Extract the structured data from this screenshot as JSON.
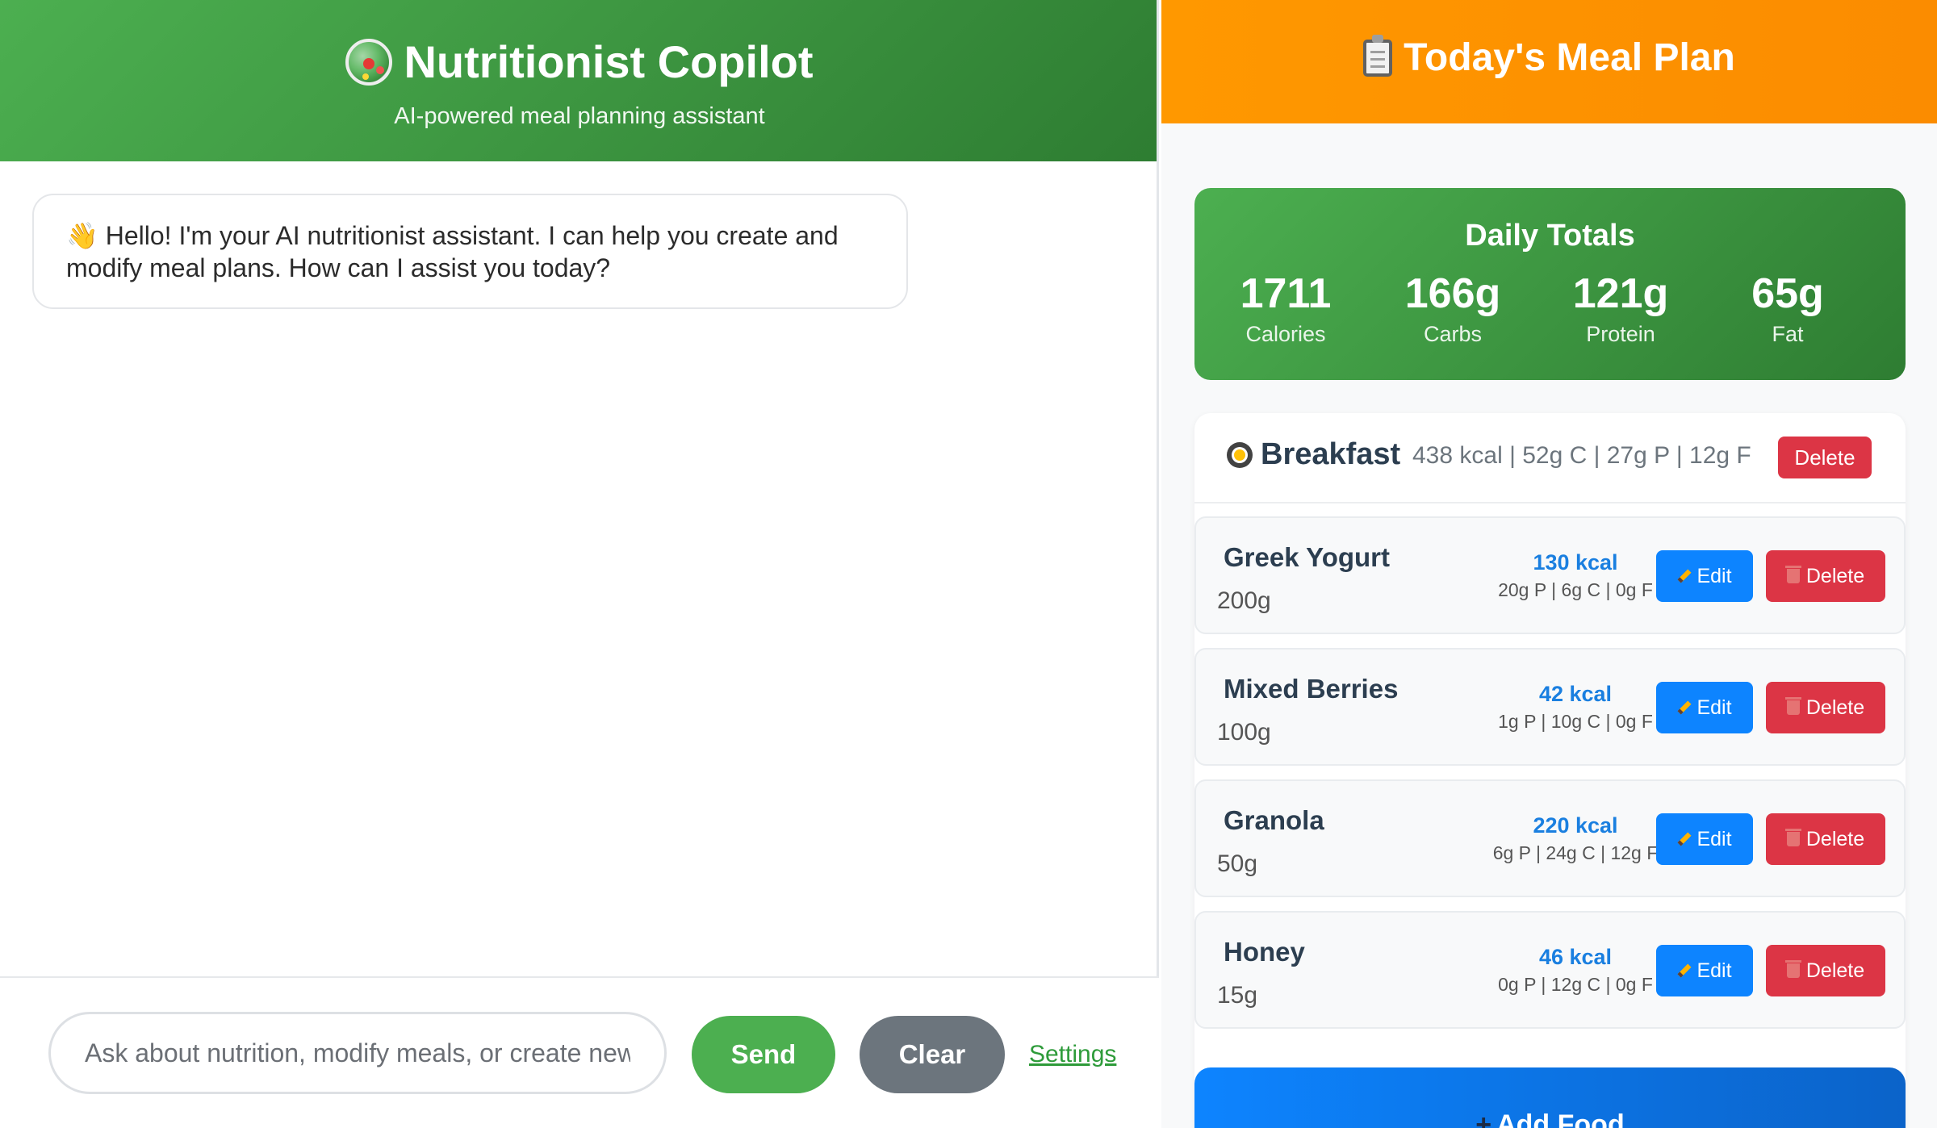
{
  "chat": {
    "title": "Nutritionist Copilot",
    "subtitle": "AI-powered meal planning assistant",
    "messages": [
      {
        "text": "👋 Hello! I'm your AI nutritionist assistant. I can help you create and modify meal plans. How can I assist you today?"
      }
    ],
    "input_placeholder": "Ask about nutrition, modify meals, or create new plans...",
    "send_label": "Send",
    "clear_label": "Clear",
    "settings_label": "Settings"
  },
  "plan": {
    "title": "Today's Meal Plan",
    "totals": {
      "title": "Daily Totals",
      "items": [
        {
          "value": "1711",
          "label": "Calories"
        },
        {
          "value": "166g",
          "label": "Carbs"
        },
        {
          "value": "121g",
          "label": "Protein"
        },
        {
          "value": "65g",
          "label": "Fat"
        }
      ]
    },
    "meals": [
      {
        "name": "Breakfast",
        "macros": "438 kcal | 52g C | 27g P | 12g F",
        "delete_label": "Delete",
        "foods": [
          {
            "name": "Greek Yogurt",
            "qty": "200g",
            "kcal": "130 kcal",
            "macros": "20g P | 6g C | 0g F",
            "edit_label": "Edit",
            "delete_label": "Delete"
          },
          {
            "name": "Mixed Berries",
            "qty": "100g",
            "kcal": "42 kcal",
            "macros": "1g P | 10g C | 0g F",
            "edit_label": "Edit",
            "delete_label": "Delete"
          },
          {
            "name": "Granola",
            "qty": "50g",
            "kcal": "220 kcal",
            "macros": "6g P | 24g C | 12g F",
            "edit_label": "Edit",
            "delete_label": "Delete"
          },
          {
            "name": "Honey",
            "qty": "15g",
            "kcal": "46 kcal",
            "macros": "0g P | 12g C | 0g F",
            "edit_label": "Edit",
            "delete_label": "Delete"
          }
        ]
      }
    ],
    "add_food_label": "Add Food"
  },
  "colors": {
    "primary_green": "#4caf50",
    "header_orange": "#ff9800",
    "accent_blue": "#0d84ff",
    "danger_red": "#dc3545",
    "neutral_gray": "#6c757d"
  }
}
